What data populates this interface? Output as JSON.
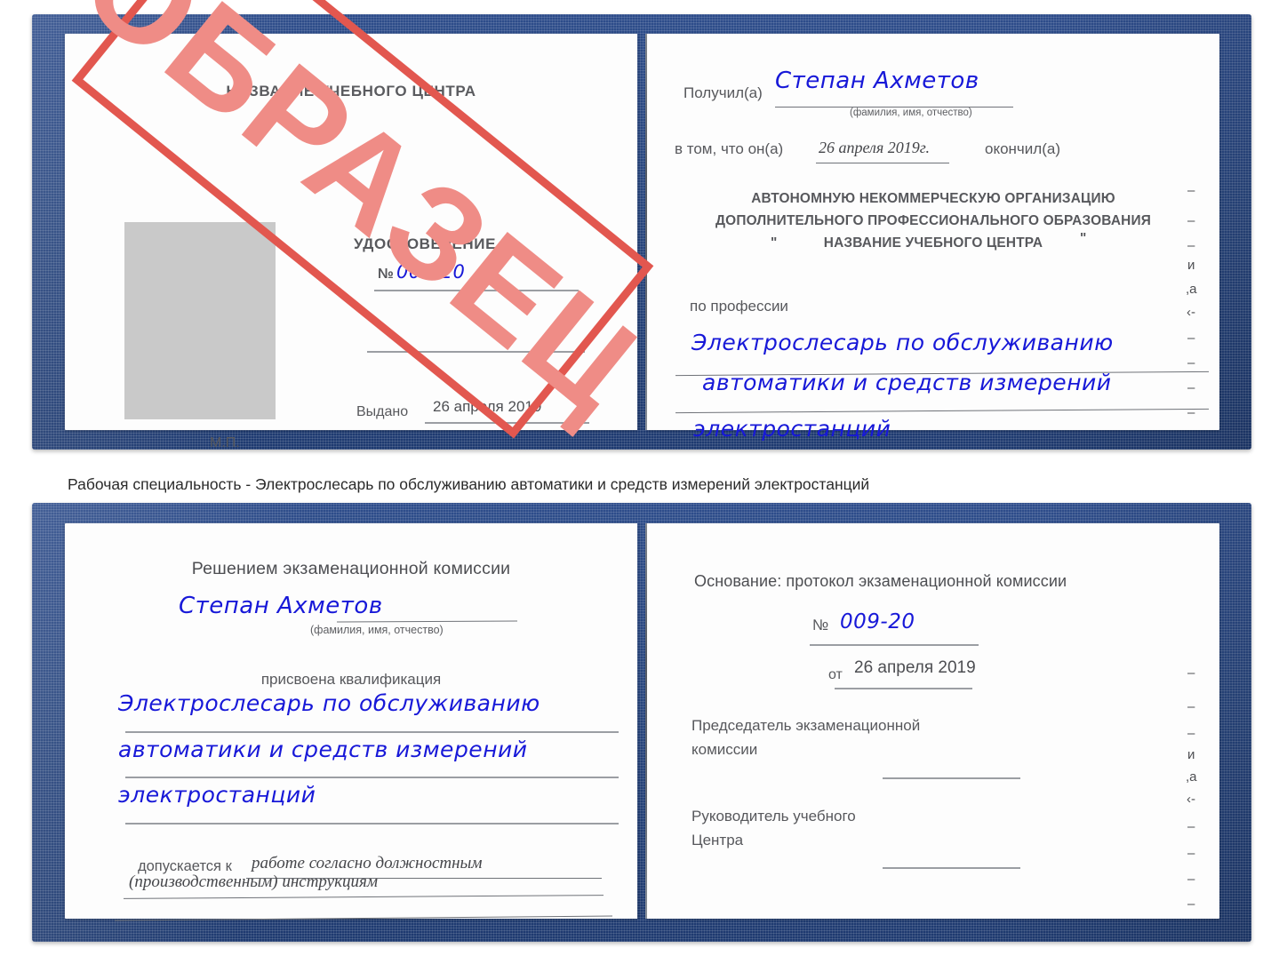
{
  "caption": {
    "text": "Рабочая специальность - Электрослесарь по обслуживанию автоматики и средств измерений электростанций"
  },
  "stamp": {
    "label": "ОБРАЗЕЦ",
    "color": "#e2574f",
    "text_color": "#ef8c86"
  },
  "colors": {
    "cover_blue": "#28467f",
    "handwriting_blue": "#1718d8",
    "paper": "#fdfdfd",
    "photo_placeholder": "#c9c9c9",
    "rule_gray": "#9b9ea3"
  },
  "certificate_1": {
    "left_page": {
      "center_name": "НАЗВАНИЕ УЧЕБНОГО ЦЕНТРА",
      "doc_type": "УДОСТОВЕРЕНИЕ",
      "number_label": "№",
      "number_value": "009-20",
      "issued_label": "Выдано",
      "issued_date": "26 апреля 2019",
      "seal_label": "М.П."
    },
    "right_page": {
      "received_label": "Получил(а)",
      "received_name": "Степан Ахметов",
      "name_hint": "(фамилия, имя, отчество)",
      "in_that_label": "в том, что он(а)",
      "finished_date": "26 апреля 2019г.",
      "finished_label": "окончил(а)",
      "org_line1": "АВТОНОМНУЮ НЕКОММЕРЧЕСКУЮ ОРГАНИЗАЦИЮ",
      "org_line2": "ДОПОЛНИТЕЛЬНОГО ПРОФЕССИОНАЛЬНОГО ОБРАЗОВАНИЯ",
      "org_quote_open": "\"",
      "org_line3": "НАЗВАНИЕ УЧЕБНОГО ЦЕНТРА",
      "org_quote_close": "\"",
      "profession_label": "по профессии",
      "profession_line1": "Электрослесарь по обслуживанию",
      "profession_line2": "автоматики и средств измерений",
      "profession_line3": "электростанций",
      "edge_marks": [
        "–",
        "–",
        "–",
        "и",
        "а",
        "‹-",
        "–",
        "–",
        "–",
        "–"
      ]
    }
  },
  "certificate_2": {
    "left_page": {
      "decision_label": "Решением экзаменационной комиссии",
      "name": "Степан Ахметов",
      "name_hint": "(фамилия, имя, отчество)",
      "qualification_label": "присвоена квалификация",
      "qualification_line1": "Электрослесарь по обслуживанию",
      "qualification_line2": "автоматики и средств измерений",
      "qualification_line3": "электростанций",
      "admitted_label": "допускается к",
      "admitted_line1": "работе согласно должностным",
      "admitted_line2": "(производственным) инструкциям"
    },
    "right_page": {
      "basis_label": "Основание: протокол экзаменационной комиссии",
      "number_label": "№",
      "number_value": "009-20",
      "date_label": "от",
      "date_value": "26 апреля 2019",
      "chair_line1": "Председатель экзаменационной",
      "chair_line2": "комиссии",
      "head_line1": "Руководитель учебного",
      "head_line2": "Центра",
      "edge_marks": [
        "–",
        "–",
        "–",
        "и",
        "а",
        "‹-",
        "–",
        "–",
        "–",
        "–"
      ]
    }
  }
}
